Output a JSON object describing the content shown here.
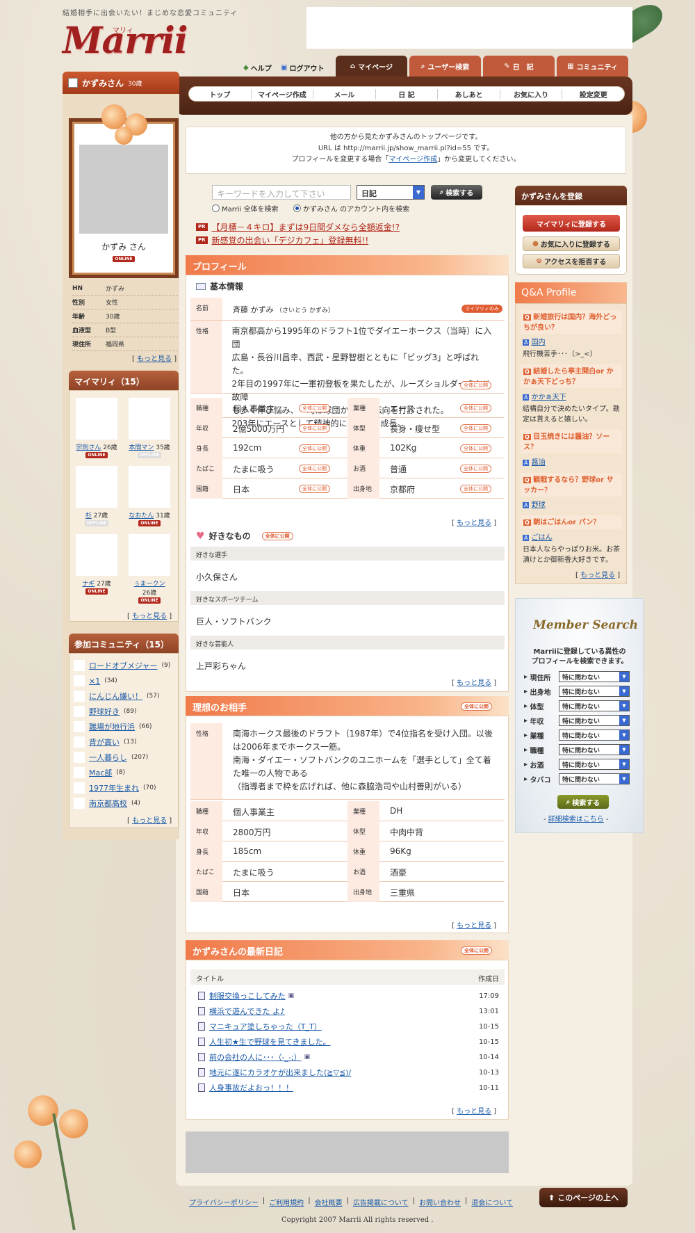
{
  "header": {
    "tagline": "結婚相手に出会いたい！まじめな恋愛コミュニティ",
    "logo": "Marrii",
    "logo_kana": "マリィ"
  },
  "util": {
    "help": "ヘルプ",
    "logout": "ログアウト"
  },
  "tabs": [
    {
      "label": "マイページ"
    },
    {
      "label": "ユーザー検索"
    },
    {
      "label": "日　記"
    },
    {
      "label": "コミュニティ"
    }
  ],
  "nav": [
    "トップ",
    "マイページ作成",
    "メール",
    "日 記",
    "あしあと",
    "お気に入り",
    "設定変更"
  ],
  "user": {
    "name": "かずみさん",
    "age": "30歳",
    "display_name": "かずみ さん",
    "status": "ONLINE"
  },
  "info": [
    {
      "k": "HN",
      "v": "かずみ"
    },
    {
      "k": "性別",
      "v": "女性"
    },
    {
      "k": "年齢",
      "v": "30歳"
    },
    {
      "k": "血液型",
      "v": "B型"
    },
    {
      "k": "現住所",
      "v": "福岡県"
    }
  ],
  "more": "もっと見る",
  "mymarrii": {
    "title": "マイマリィ（15）",
    "friends": [
      {
        "name": "宗則さん",
        "age": "26歳",
        "status": "ONLINE"
      },
      {
        "name": "本間マン",
        "age": "35歳",
        "status": "OFFLINE"
      },
      {
        "name": "杉",
        "age": "27歳",
        "status": "OFFLINE"
      },
      {
        "name": "なおたん",
        "age": "31歳",
        "status": "ONLINE"
      },
      {
        "name": "ナギ",
        "age": "27歳",
        "status": "ONLINE"
      },
      {
        "name": "ぅまークン",
        "age": "26歳",
        "status": "ONLINE"
      }
    ]
  },
  "community": {
    "title": "参加コミュニティ（15）",
    "items": [
      {
        "name": "ロードオブメジャー",
        "count": "(9)"
      },
      {
        "name": "×1",
        "count": "(34)"
      },
      {
        "name": "にんじん嫌い！",
        "count": "(57)"
      },
      {
        "name": "野球好き",
        "count": "(89)"
      },
      {
        "name": "職場が地行浜",
        "count": "(66)"
      },
      {
        "name": "背が高い",
        "count": "(13)"
      },
      {
        "name": "一人暮らし",
        "count": "(207)"
      },
      {
        "name": "Mac部",
        "count": "(8)"
      },
      {
        "name": "1977年生まれ",
        "count": "(70)"
      },
      {
        "name": "南京都高校",
        "count": "(4)"
      }
    ]
  },
  "notice": {
    "line1": "他の方から見たかずみさんのトップページです。",
    "line2": "URL は http://marrii.jp/show_marrii.pl?id=55 です。",
    "line3a": "プロフィールを変更する場合「",
    "line3_link": "マイページ作成",
    "line3b": "」から変更してください。"
  },
  "search": {
    "placeholder": "キーワードを入力して下さい",
    "select": "日記",
    "button": "検索する",
    "radio1": "Marrii 全体を検索",
    "radio2": "かずみさん のアカウント内を検索"
  },
  "pr": [
    {
      "tag": "PR",
      "text": "【月標－４キロ】まずは9日間ダメなら全額返金!?"
    },
    {
      "tag": "PR",
      "text": "新感覚の出会い「デジカフェ」登録無料!!"
    }
  ],
  "profile": {
    "title": "プロフィール",
    "basic": "基本情報",
    "name_label": "名前",
    "name_value": "斉藤 かずみ",
    "name_kana": "（さいとう かずみ）",
    "name_badge": "マイマリィのみ",
    "personality_label": "性格",
    "personality": [
      "南京都高から1995年のドラフト1位でダイエーホークス（当時）に入団",
      "広島・長谷川昌幸、西武・星野智樹とともに「ビッグ3」と呼ばれた。",
      "2年目の1997年に一軍初登板を果たしたが、ルーズショルダーのため故障",
      "も多く伸び悩み、一時は球団から打者転向を打診された。",
      "203年にエースとして精神的にも大きく成長。"
    ],
    "public": "全体に公開",
    "rows": [
      {
        "l1": "職種",
        "v1": "個人事業主",
        "l2": "業種",
        "v2": "エース"
      },
      {
        "l1": "年収",
        "v1": "2億5000万円",
        "l2": "体型",
        "v2": "長身・痩せ型"
      },
      {
        "l1": "身長",
        "v1": "192cm",
        "l2": "体重",
        "v2": "102Kg"
      },
      {
        "l1": "たばこ",
        "v1": "たまに吸う",
        "l2": "お酒",
        "v2": "普通"
      },
      {
        "l1": "国籍",
        "v1": "日本",
        "l2": "出身地",
        "v2": "京都府"
      }
    ],
    "likes_title": "好きなもの",
    "likes": [
      {
        "label": "好きな選手",
        "value": "小久保さん"
      },
      {
        "label": "好きなスポーツチーム",
        "value": "巨人・ソフトバンク"
      },
      {
        "label": "好きな芸能人",
        "value": "上戸彩ちゃん"
      }
    ]
  },
  "ideal": {
    "title": "理想のお相手",
    "public": "全体に公開",
    "personality_label": "性格",
    "personality": [
      "南海ホークス最後のドラフト（1987年）で4位指名を受け入団。以後",
      "は2006年までホークス一筋。",
      "南海・ダイエー・ソフトバンクのユニホームを「選手として」全て着",
      "た唯一の人物である",
      "（指導者まで枠を広げれば、他に森脇浩司や山村善則がいる）"
    ],
    "rows": [
      {
        "l1": "職種",
        "v1": "個人事業主",
        "l2": "業種",
        "v2": "DH"
      },
      {
        "l1": "年収",
        "v1": "2800万円",
        "l2": "体型",
        "v2": "中肉中背"
      },
      {
        "l1": "身長",
        "v1": "185cm",
        "l2": "体重",
        "v2": "96Kg"
      },
      {
        "l1": "たばこ",
        "v1": "たまに吸う",
        "l2": "お酒",
        "v2": "酒豪"
      },
      {
        "l1": "国籍",
        "v1": "日本",
        "l2": "出身地",
        "v2": "三重県"
      }
    ]
  },
  "diary": {
    "title": "かずみさんの最新日記",
    "public": "全体に公開",
    "col_title": "タイトル",
    "col_date": "作成日",
    "items": [
      {
        "title": "制服交換っこしてみた",
        "date": "17:09"
      },
      {
        "title": "横浜で遊んできた よ♪",
        "date": "13:01"
      },
      {
        "title": "マニキュア塗しちゃった（T_T）",
        "date": "10-15"
      },
      {
        "title": "人生初★生で野球を見てきました。",
        "date": "10-15"
      },
      {
        "title": "前の会社の人に･･･（-_-;）",
        "date": "10-14"
      },
      {
        "title": "地元に遂にカラオケが出来ました(≧▽≦)/",
        "date": "10-13"
      },
      {
        "title": "人身事故だよおっ！！！",
        "date": "10-11"
      }
    ]
  },
  "register": {
    "title": "かずみさんを登録",
    "btn1": "マイマリィに登録する",
    "btn2": "お気に入りに登録する",
    "btn3": "アクセスを拒否する"
  },
  "qa": {
    "title": "Q&A Profile",
    "items": [
      {
        "q": "新婚旅行は国内？海外どっちが良い？",
        "a_link": "国内",
        "a_text": "飛行機苦手･･･（>_<）"
      },
      {
        "q": "結婚したら亭主関白or かかぁ天下どっち？",
        "a_link": "かかぁ天下",
        "a_text": "結構自分で決めたいタイプ。勘定は貰えると嬉しい。"
      },
      {
        "q": "目玉焼きには醤油？ソース？",
        "a_link": "醤油",
        "a_text": ""
      },
      {
        "q": "観戦するなら？野球or サッカー？",
        "a_link": "野球",
        "a_text": ""
      },
      {
        "q": "朝はごはんor パン？",
        "a_link": "ごはん",
        "a_text": "日本人ならやっぱりお米。お茶漬けとか御新香大好きです。"
      }
    ]
  },
  "member_search": {
    "title": "Member Search",
    "desc1": "Marriiに登録している異性の",
    "desc2": "プロフィールを検索できます。",
    "rows": [
      {
        "k": "現住所",
        "v": "特に問わない"
      },
      {
        "k": "出身地",
        "v": "特に問わない"
      },
      {
        "k": "体型",
        "v": "特に問わない"
      },
      {
        "k": "年収",
        "v": "特に問わない"
      },
      {
        "k": "業種",
        "v": "特に問わない"
      },
      {
        "k": "職種",
        "v": "特に問わない"
      },
      {
        "k": "お酒",
        "v": "特に問わない"
      },
      {
        "k": "タバコ",
        "v": "特に問わない"
      }
    ],
    "button": "検索する",
    "detail": "詳細検索はこちら"
  },
  "footer": {
    "links": [
      "プライバシーポリシー",
      "ご利用規約",
      "会社概要",
      "広告掲載について",
      "お問い合わせ",
      "退会について"
    ],
    "copyright": "Copyright 2007 Marrii All rights reserved .",
    "totop": "このページの上へ"
  },
  "colors": {
    "accent": "#f07a4a",
    "brown": "#5a2e1a",
    "link": "#1a5aa8",
    "red": "#b3281c"
  }
}
